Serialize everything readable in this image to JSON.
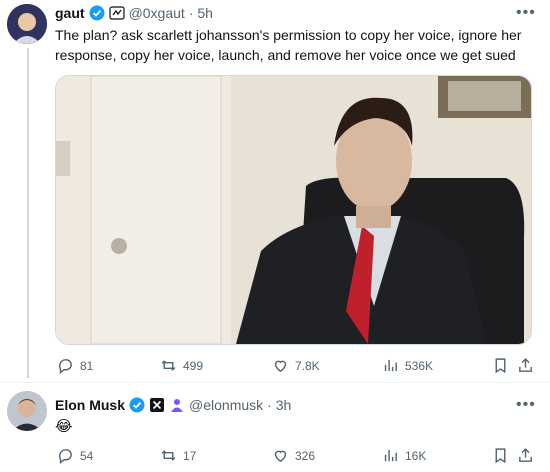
{
  "tweet1": {
    "name": "gaut",
    "handle": "@0xgaut",
    "time": "· 5h",
    "text": "The plan? ask scarlett johansson's permission to copy her voice, ignore her response, copy her voice, launch, and remove her voice once we get sued",
    "stats": {
      "replies": "81",
      "reposts": "499",
      "likes": "7.8K",
      "views": "536K"
    }
  },
  "tweet2": {
    "name": "Elon Musk",
    "handle": "@elonmusk",
    "time": "· 3h",
    "text": "😂",
    "stats": {
      "replies": "54",
      "reposts": "17",
      "likes": "326",
      "views": "16K"
    }
  },
  "colors": {
    "verified": "#1d9bf0",
    "muted": "#536471",
    "accent_purple": "#7856ff"
  },
  "icons": [
    "more-icon",
    "verified-badge-icon",
    "reply-icon",
    "repost-icon",
    "like-icon",
    "views-icon",
    "bookmark-icon",
    "share-icon",
    "x-logo-icon",
    "affiliate-badge-icon"
  ]
}
